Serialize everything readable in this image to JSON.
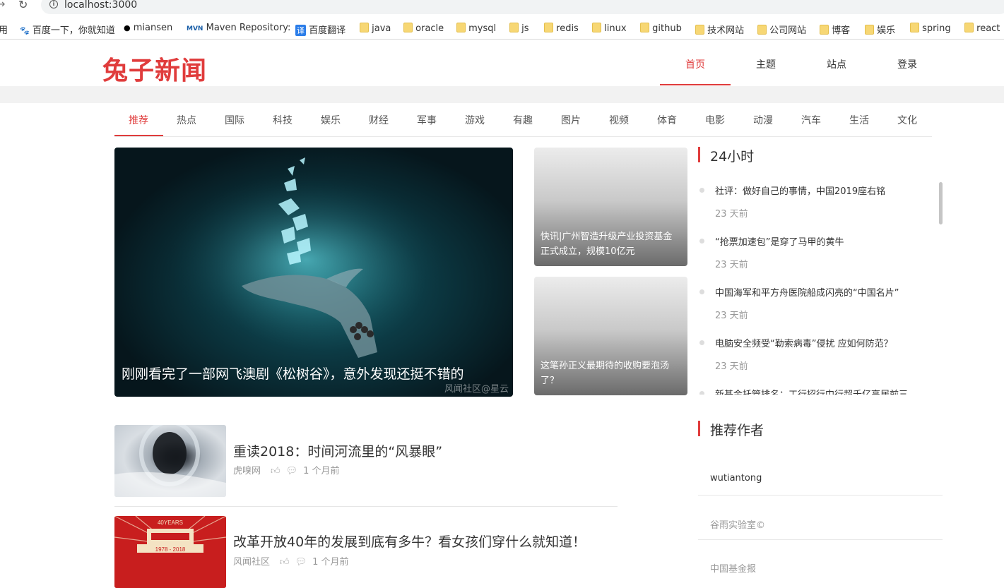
{
  "browser": {
    "url": "localhost:3000",
    "bookmarks": [
      {
        "label": "用",
        "icon": "apps"
      },
      {
        "label": "百度一下，你就知道",
        "icon": "baidu-paw"
      },
      {
        "label": "miansen",
        "icon": "github"
      },
      {
        "label": "Maven Repository: ",
        "icon": "mvn"
      },
      {
        "label": "百度翻译",
        "icon": "translate"
      },
      {
        "label": "java",
        "icon": "folder"
      },
      {
        "label": "oracle",
        "icon": "folder"
      },
      {
        "label": "mysql",
        "icon": "folder"
      },
      {
        "label": "js",
        "icon": "folder"
      },
      {
        "label": "redis",
        "icon": "folder"
      },
      {
        "label": "linux",
        "icon": "folder"
      },
      {
        "label": "github",
        "icon": "folder"
      },
      {
        "label": "技术网站",
        "icon": "folder"
      },
      {
        "label": "公司网站",
        "icon": "folder"
      },
      {
        "label": "博客",
        "icon": "folder"
      },
      {
        "label": "娱乐",
        "icon": "folder"
      },
      {
        "label": "spring",
        "icon": "folder"
      },
      {
        "label": "react",
        "icon": "folder"
      }
    ]
  },
  "site": {
    "logo": "兔子新闻",
    "brand_color": "#e03c3c",
    "top_nav": [
      "首页",
      "主题",
      "站点",
      "登录"
    ],
    "active_top_nav": "首页"
  },
  "categories": [
    "推荐",
    "热点",
    "国际",
    "科技",
    "娱乐",
    "财经",
    "军事",
    "游戏",
    "有趣",
    "图片",
    "视频",
    "体育",
    "电影",
    "动漫",
    "汽车",
    "生活",
    "文化"
  ],
  "hero": {
    "title": "刚刚看完了一部网飞澳剧《松树谷》，意外发现还挺不错的",
    "watermark": "风闻社区@星云"
  },
  "side_cards": [
    {
      "title": "快讯|广州智造升级产业投资基金正式成立，规模10亿元"
    },
    {
      "title": "这笔孙正义最期待的收购要泡汤了？"
    }
  ],
  "hours24": {
    "title": "24小时",
    "items": [
      {
        "title": "社评：做好自己的事情，中国2019座右铭",
        "time": "23 天前"
      },
      {
        "title": "“抢票加速包”是穿了马甲的黄牛",
        "time": "23 天前"
      },
      {
        "title": "中国海军和平方舟医院船成闪亮的“中国名片”",
        "time": "23 天前"
      },
      {
        "title": "电脑安全频受“勒索病毒”侵扰 应如何防范？",
        "time": "23 天前"
      },
      {
        "title": "新基金托管排名：工行招行中行超千亿高居前三",
        "time": ""
      }
    ]
  },
  "articles": [
    {
      "title": "重读2018：时间河流里的“风暴眼”",
      "source": "虎嗅网",
      "time": "1 个月前",
      "thumb": "storm-eye"
    },
    {
      "title": "改革开放40年的发展到底有多牛？看女孩们穿什么就知道！",
      "source": "风闻社区",
      "time": "1 个月前",
      "thumb": "40years-poster",
      "poster_text": "40YEARS",
      "poster_years": "1978 - 2018"
    }
  ],
  "authors": {
    "title": "推荐作者",
    "items": [
      "wutiantong",
      "谷雨实验室©",
      "中国基金报"
    ]
  }
}
